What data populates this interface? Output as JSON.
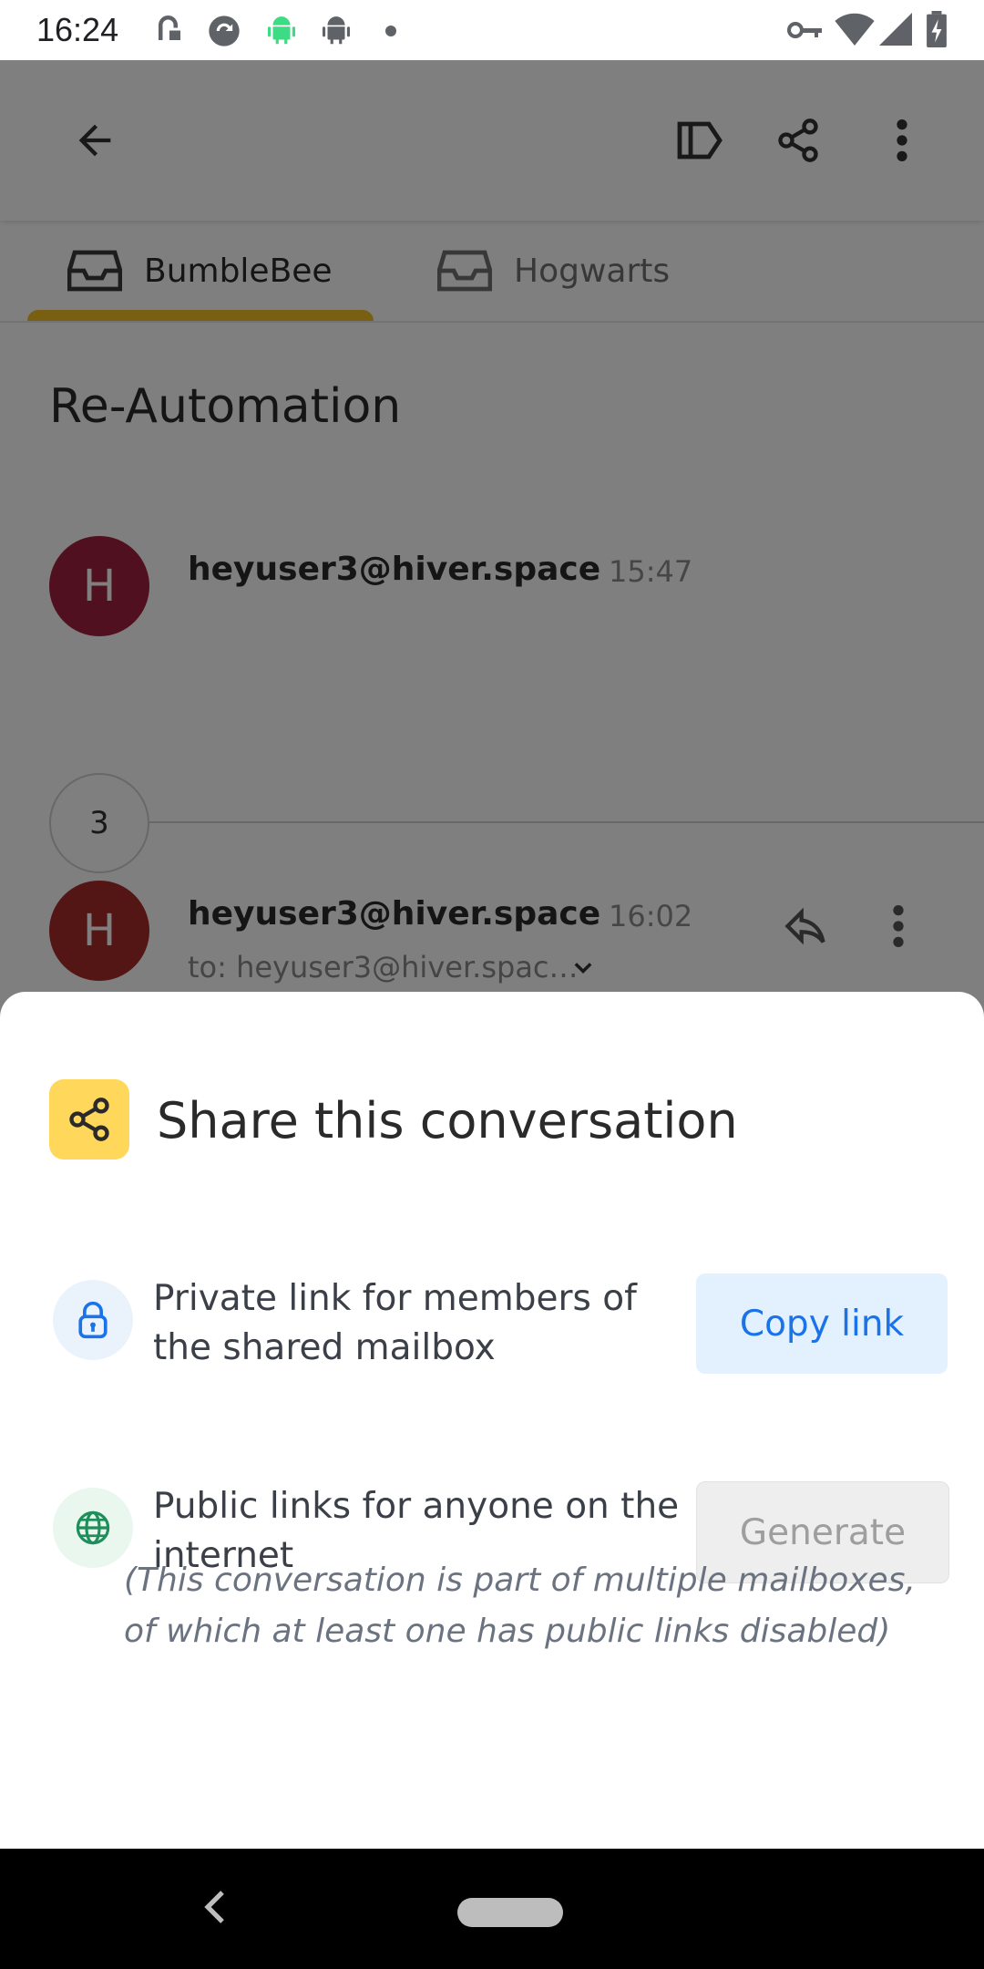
{
  "status_bar": {
    "time": "16:24"
  },
  "toolbar": {
    "back_icon": "arrow-left-icon",
    "label_icon": "label-icon",
    "share_icon": "share-icon",
    "more_icon": "more-vert-icon"
  },
  "tabs": [
    {
      "label": "BumbleBee",
      "active": true
    },
    {
      "label": "Hogwarts",
      "active": false
    }
  ],
  "conversation": {
    "subject": "Re-Automation",
    "messages": [
      {
        "avatar_letter": "H",
        "avatar_color": "#a3203e",
        "sender": "heyuser3@hiver.space",
        "time": "15:47"
      },
      {
        "avatar_letter": "H",
        "avatar_color": "#a82a2a",
        "sender": "heyuser3@hiver.space",
        "time": "16:02",
        "to": "to: heyuser3@hiver.spac…"
      }
    ],
    "collapsed_count": "3"
  },
  "share_sheet": {
    "title": "Share this conversation",
    "private": {
      "text": "Private link for members of the shared mailbox",
      "button": "Copy link"
    },
    "public": {
      "text": "Public links for anyone on the internet",
      "button": "Generate"
    },
    "note": "(This conversation is part of multiple mailboxes, of which at least one has public links disabled)"
  },
  "colors": {
    "accent_yellow": "#f2bf24",
    "copy_btn_bg": "#e3f0fd",
    "copy_btn_text": "#1a73e8",
    "disabled_btn_bg": "#eeeeee",
    "disabled_btn_text": "#9e9e9e"
  }
}
